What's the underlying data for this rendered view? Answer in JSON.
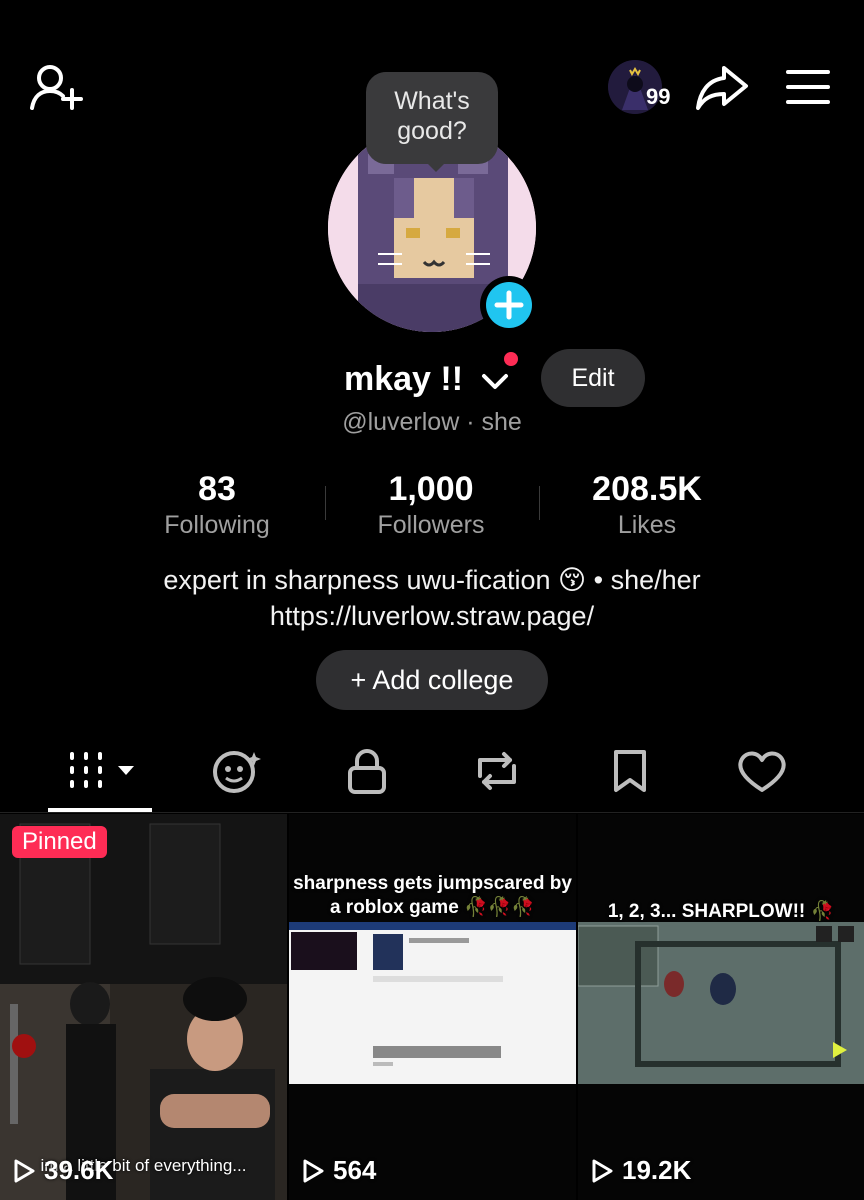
{
  "header": {
    "notification_count": "99"
  },
  "profile": {
    "tooltip": "What's good?",
    "display_name": "mkay !!",
    "edit_label": "Edit",
    "handle": "@luverlow · she",
    "stats": [
      {
        "value": "83",
        "label": "Following"
      },
      {
        "value": "1,000",
        "label": "Followers"
      },
      {
        "value": "208.5K",
        "label": "Likes"
      }
    ],
    "bio_line1": "expert in sharpness uwu-fication 😚 • she/her",
    "bio_line2": "https://luverlow.straw.page/",
    "add_college": "+ Add college"
  },
  "tabs": [
    "grid-icon",
    "reposts-face-icon",
    "lock-icon",
    "repost-icon",
    "bookmark-icon",
    "heart-icon"
  ],
  "videos": [
    {
      "pinned": "Pinned",
      "caption": "im a little bit of everything...",
      "views": "39.6K"
    },
    {
      "caption": "sharpness gets jumpscared by a roblox game 🥀🥀🥀",
      "views": "564"
    },
    {
      "caption": "1, 2, 3... SHARPLOW!! 🥀",
      "views": "19.2K"
    }
  ],
  "colors": {
    "accent_red": "#fe2c55",
    "accent_blue": "#20c5f0",
    "button_bg": "#2f2f31"
  }
}
